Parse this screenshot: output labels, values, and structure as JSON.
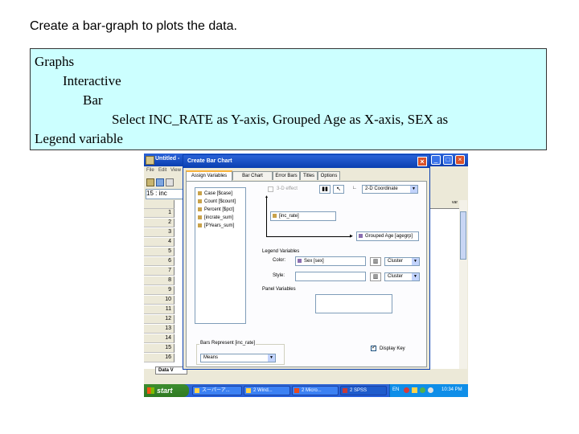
{
  "slide": {
    "title": "Create a bar-graph to plots the data.",
    "instructions": [
      "Graphs",
      "Interactive",
      "Bar",
      "Select INC_RATE as Y-axis, Grouped Age as X-axis, SEX as",
      "Legend variable"
    ]
  },
  "colors": {
    "note_background": "#ccffff",
    "xp_titlebar": "#0a3fb0",
    "taskbar": "#245edb",
    "start_button": "#3c8d2f"
  },
  "spss_window": {
    "title": "Untitled -",
    "menu": [
      "File",
      "Edit",
      "View"
    ],
    "cell_ref": "15 : inc",
    "row_numbers": [
      "1",
      "2",
      "3",
      "4",
      "5",
      "6",
      "7",
      "8",
      "9",
      "10",
      "11",
      "12",
      "13",
      "14",
      "15",
      "16"
    ],
    "right_column_header": "var",
    "data_tab": "Data V"
  },
  "dialog": {
    "title": "Create Bar Chart",
    "tabs": [
      "Assign Variables",
      "Bar Chart Options",
      "Error Bars",
      "Titles",
      "Options"
    ],
    "variables": [
      "Case [$case]",
      "Count [$count]",
      "Percent [$pct]",
      "[incrate_sum]",
      "[PYears_sum]"
    ],
    "three_d_effect": "3-D effect",
    "coordinate": "2-D Coordinate",
    "y_axis_field": "[inc_rate]",
    "x_axis_field": "Grouped Age [agegrp]",
    "legend_header": "Legend Variables",
    "color_label": "Color:",
    "color_field": "Sex [sex]",
    "color_mode": "Cluster",
    "style_label": "Style:",
    "style_mode": "Cluster",
    "panel_header": "Panel Variables",
    "bars_represent": "Bars Represent [inc_rate]",
    "bars_value": "Means",
    "display_key": "Display Key"
  },
  "taskbar": {
    "start": "start",
    "tasks": [
      "スーパーア...",
      "2 Wind...",
      "2 Micro...",
      "2 SPSS"
    ],
    "lang": "EN",
    "clock": "10:34 PM"
  }
}
